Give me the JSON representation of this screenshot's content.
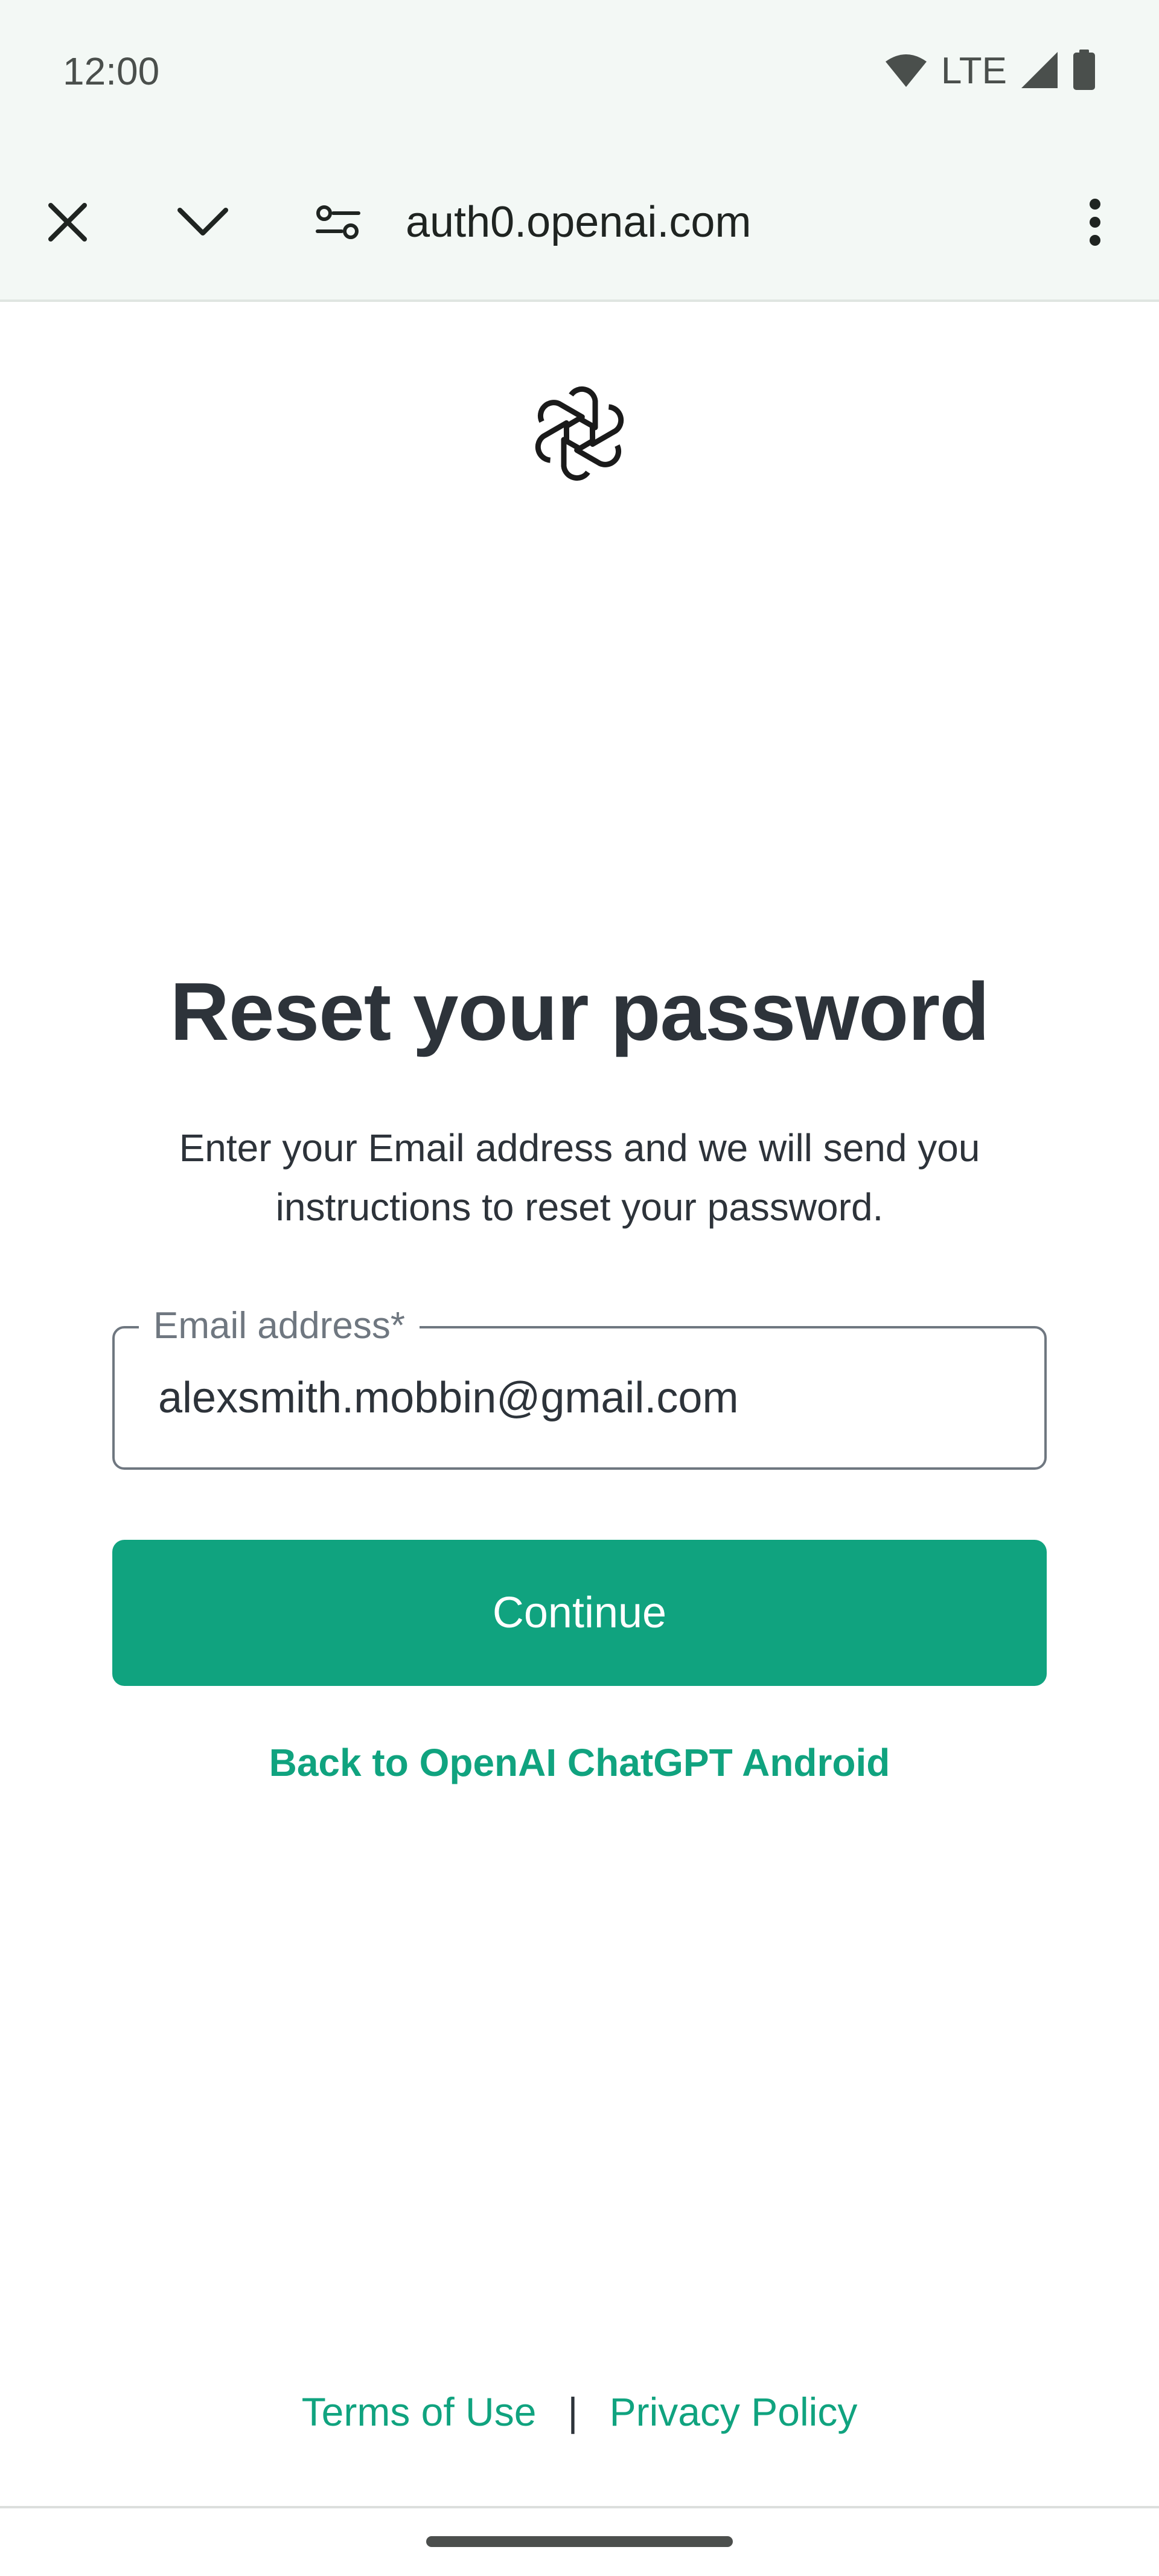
{
  "status_bar": {
    "time": "12:00",
    "network": "LTE",
    "icons": [
      "wifi-icon",
      "signal-icon",
      "battery-icon"
    ]
  },
  "browser": {
    "url": "auth0.openai.com",
    "icons": [
      "close-icon",
      "chevron-down-icon",
      "site-settings-icon",
      "more-vert-icon"
    ]
  },
  "page": {
    "logo": "openai-logo",
    "title": "Reset your password",
    "description": "Enter your Email address and we will send you instructions to reset your password.",
    "email": {
      "label": "Email address*",
      "value": "alexsmith.mobbin@gmail.com"
    },
    "continue_label": "Continue",
    "back_link": "Back to OpenAI ChatGPT Android"
  },
  "footer": {
    "terms": "Terms of Use",
    "separator": "|",
    "privacy": "Privacy Policy"
  },
  "colors": {
    "accent": "#10a37f",
    "text": "#2d333a",
    "chrome_background": "#f3f8f5"
  }
}
